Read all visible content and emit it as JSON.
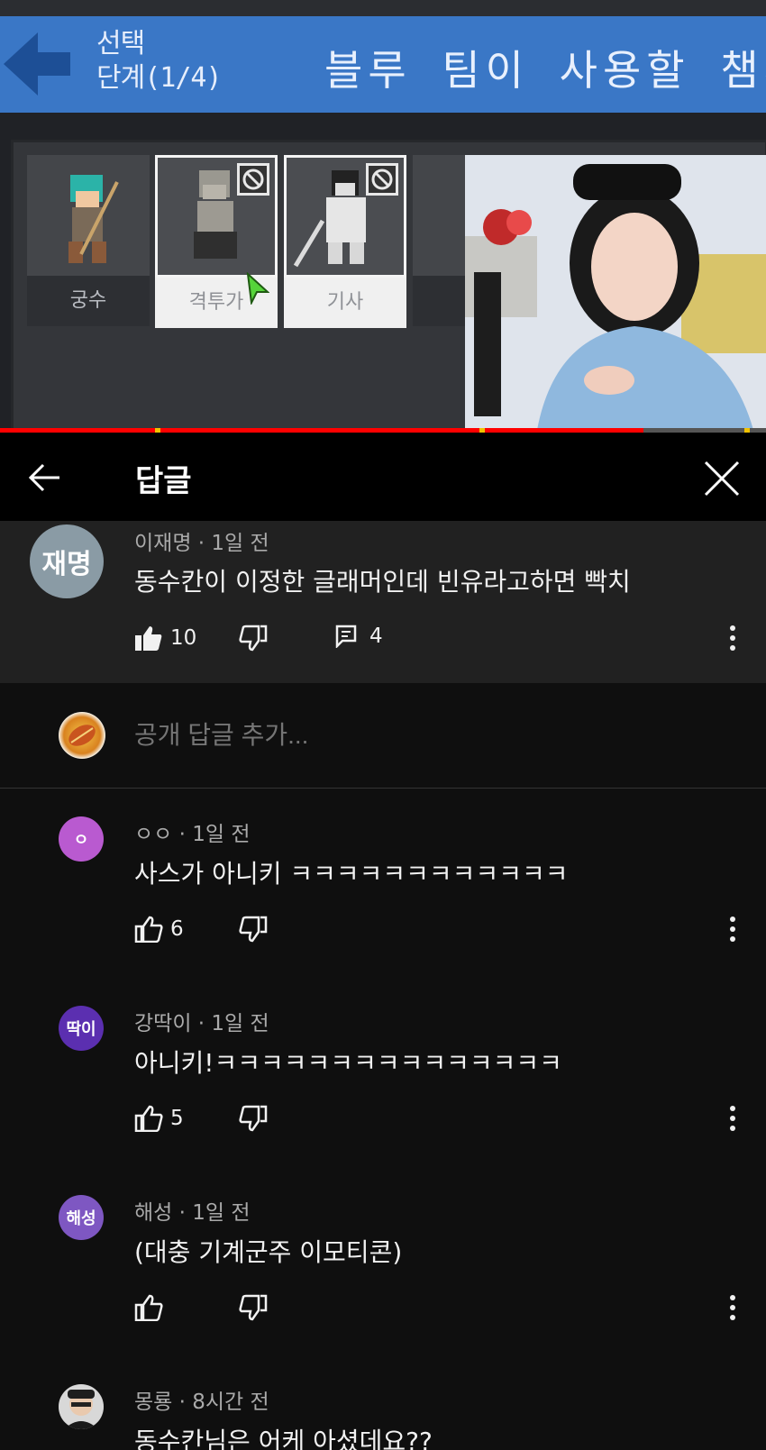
{
  "video": {
    "step_label_line1": "선택",
    "step_label_line2": "단계(1/4)",
    "game_title": "블루 팀이 사용할 챔피언",
    "champions": [
      {
        "name": "궁수",
        "banned": false
      },
      {
        "name": "격투가",
        "banned": true
      },
      {
        "name": "기사",
        "banned": true
      }
    ],
    "progress": 0.84,
    "colors": {
      "header": "#3a77c6",
      "progress": "#ff0000",
      "chapter_mark": "#f2c200"
    }
  },
  "replies_panel": {
    "title": "답글",
    "back_icon": "arrow-left-icon",
    "close_icon": "close-icon"
  },
  "parent_comment": {
    "avatar_text": "재명",
    "avatar_color": "#8a9ba5",
    "author": "이재명",
    "time": "1일 전",
    "meta": "이재명 · 1일 전",
    "text": "동수칸이 이정한 글래머인데 빈유라고하면 빡치",
    "likes": "10",
    "reply_count": "4"
  },
  "add_reply": {
    "placeholder": "공개 답글 추가..."
  },
  "replies": [
    {
      "avatar_text": "ㅇ",
      "avatar_color": "#b95ad0",
      "meta": "ㅇㅇ · 1일 전",
      "text": "사스가 아니키 ㅋㅋㅋㅋㅋㅋㅋㅋㅋㅋㅋㅋ",
      "likes": "6"
    },
    {
      "avatar_text": "딱이",
      "avatar_color": "#5b2fb0",
      "meta": "강딱이 · 1일 전",
      "text": "아니키!ㅋㅋㅋㅋㅋㅋㅋㅋㅋㅋㅋㅋㅋㅋㅋ",
      "likes": "5"
    },
    {
      "avatar_text": "해성",
      "avatar_color": "#7e57c2",
      "meta": "해성 · 1일 전",
      "text": "(대충 기계군주 이모티콘)",
      "likes": ""
    },
    {
      "avatar_text": "",
      "avatar_color": "#3c3c3c",
      "meta": "몽룡 · 8시간 전",
      "text": "동수칸님은 어케 아셨데요??",
      "likes": ""
    }
  ]
}
